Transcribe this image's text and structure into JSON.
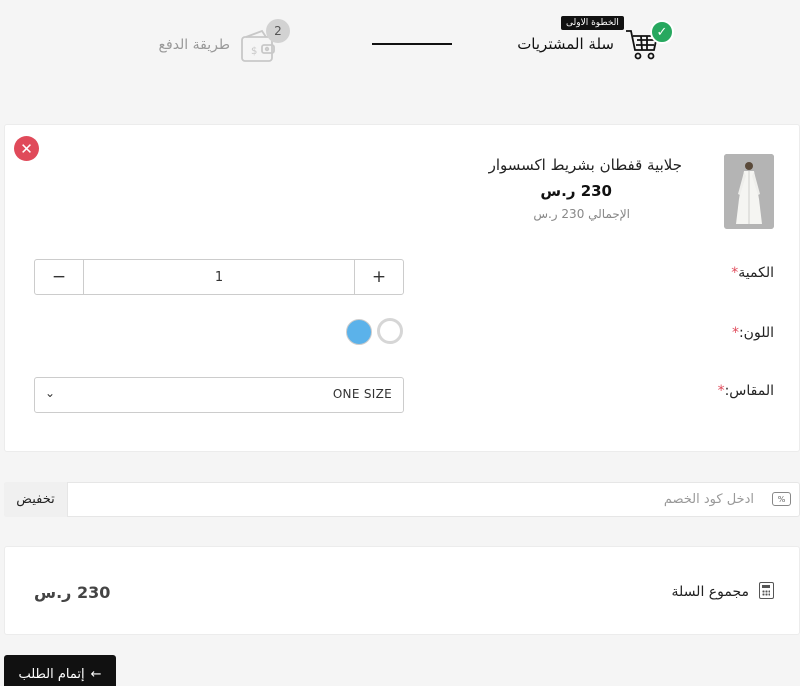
{
  "stepper": {
    "step1_label": "سلة المشتريات",
    "step1_tooltip": "الخطوة الاولى",
    "step1_check": "✓",
    "step2_label": "طريقة الدفع",
    "step2_number": "2"
  },
  "cart_item": {
    "name": "جلابية قفطان بشريط اكسسوار",
    "price": "230 ر.س",
    "total": "الإجمالي 230 ر.س",
    "remove_symbol": "✕",
    "quantity_label": "الكمية",
    "quantity_value": "1",
    "minus_symbol": "−",
    "plus_symbol": "+",
    "required_mark": "*",
    "color_label": "اللون:",
    "colors": [
      "#ffffff",
      "#5bb2ea"
    ],
    "size_label": "المقاس:",
    "size_value": "ONE SIZE",
    "chevron": "⌄"
  },
  "discount": {
    "placeholder": "ادخل كود الخصم",
    "button_label": "تخفيض",
    "icon_text": "%"
  },
  "totals": {
    "label": "مجموع السلة",
    "value": "230 ر.س"
  },
  "checkout": {
    "label": "إتمام الطلب",
    "arrow": "←"
  }
}
